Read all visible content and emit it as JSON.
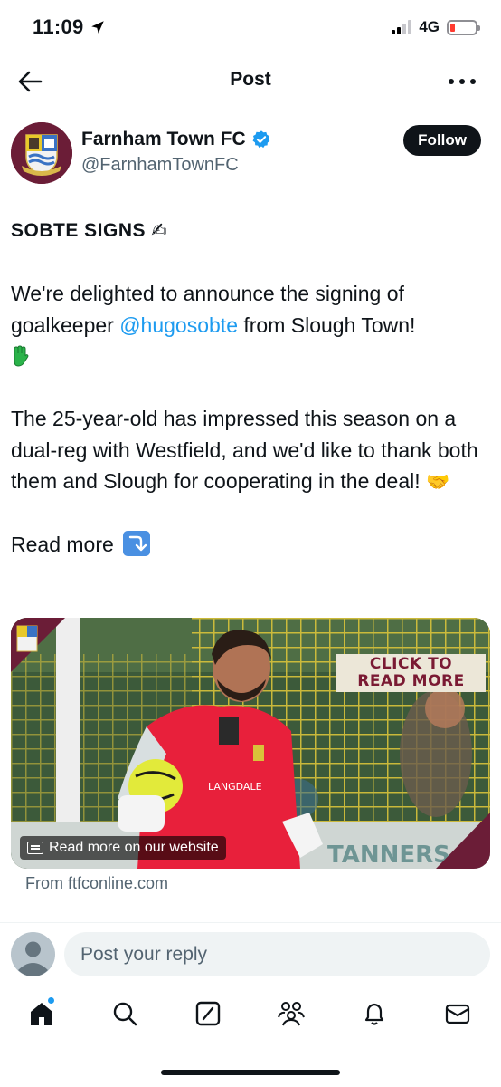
{
  "status_bar": {
    "time": "11:09",
    "network": "4G",
    "battery_level": 0.12,
    "colors": {
      "battery_low": "#ff3b30"
    }
  },
  "nav": {
    "title": "Post",
    "back_icon": "arrow-left-icon",
    "more_icon": "more-horizontal-icon"
  },
  "author": {
    "name": "Farnham Town FC",
    "handle": "@FarnhamTownFC",
    "verified": true,
    "follow_label": "Follow",
    "avatar_icon": "club-crest-icon"
  },
  "post": {
    "headline": "SOBTE SIGNS",
    "headline_emoji": "✍",
    "para1_before": "We're delighted to announce the signing of goalkeeper ",
    "mention": "@hugosobte",
    "para1_after": " from Slough Town!",
    "para2": "The 25-year-old has impressed this season on a dual-reg with Westfield, and we'd like to thank both them and Slough for cooperating in the deal! ",
    "para2_emoji": "🤝",
    "read_more": "Read more "
  },
  "link_card": {
    "banner_line1": "CLICK TO",
    "banner_line2": "READ MORE",
    "overlay_text": "Read more on our website",
    "source": "From ftfconline.com",
    "colors": {
      "banner_text": "#7a1a33",
      "kit_red": "#e8203b",
      "net_yellow": "#e8c82a"
    }
  },
  "reply": {
    "placeholder": "Post your reply"
  },
  "tab_bar": {
    "tabs": [
      {
        "name": "home",
        "icon": "home-icon"
      },
      {
        "name": "search",
        "icon": "search-icon"
      },
      {
        "name": "grok",
        "icon": "grok-icon"
      },
      {
        "name": "communities",
        "icon": "communities-icon"
      },
      {
        "name": "notifications",
        "icon": "bell-icon"
      },
      {
        "name": "messages",
        "icon": "mail-icon"
      }
    ]
  },
  "colors": {
    "accent": "#1d9bf0",
    "text_primary": "#0f1419",
    "text_secondary": "#536471",
    "club_maroon": "#6b1d37"
  }
}
